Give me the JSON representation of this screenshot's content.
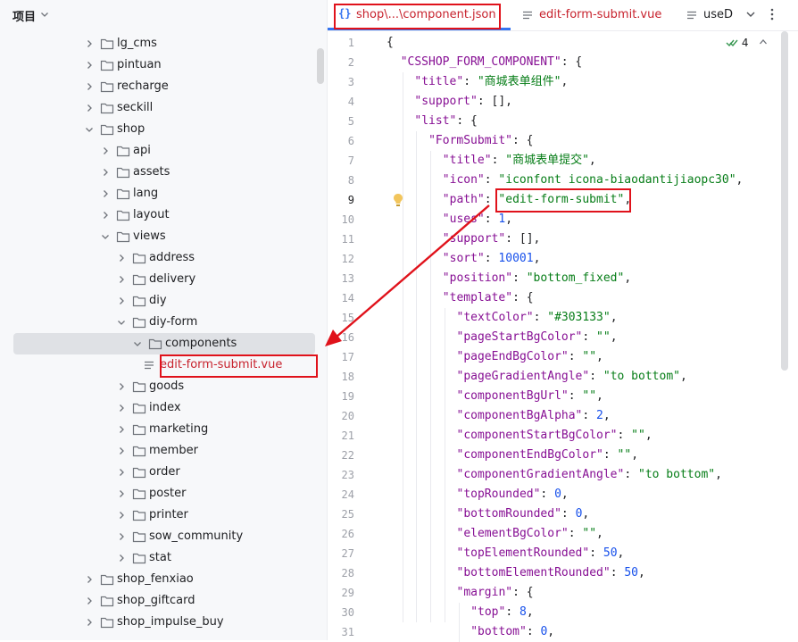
{
  "project_panel": {
    "title": "项目",
    "items": [
      {
        "label": "lg_cms",
        "depth": 0,
        "expanded": false,
        "kind": "folder"
      },
      {
        "label": "pintuan",
        "depth": 0,
        "expanded": false,
        "kind": "folder"
      },
      {
        "label": "recharge",
        "depth": 0,
        "expanded": false,
        "kind": "folder"
      },
      {
        "label": "seckill",
        "depth": 0,
        "expanded": false,
        "kind": "folder"
      },
      {
        "label": "shop",
        "depth": 0,
        "expanded": true,
        "kind": "folder"
      },
      {
        "label": "api",
        "depth": 1,
        "expanded": false,
        "kind": "folder"
      },
      {
        "label": "assets",
        "depth": 1,
        "expanded": false,
        "kind": "folder"
      },
      {
        "label": "lang",
        "depth": 1,
        "expanded": false,
        "kind": "folder"
      },
      {
        "label": "layout",
        "depth": 1,
        "expanded": false,
        "kind": "folder"
      },
      {
        "label": "views",
        "depth": 1,
        "expanded": true,
        "kind": "folder"
      },
      {
        "label": "address",
        "depth": 2,
        "expanded": false,
        "kind": "folder"
      },
      {
        "label": "delivery",
        "depth": 2,
        "expanded": false,
        "kind": "folder"
      },
      {
        "label": "diy",
        "depth": 2,
        "expanded": false,
        "kind": "folder"
      },
      {
        "label": "diy-form",
        "depth": 2,
        "expanded": true,
        "kind": "folder"
      },
      {
        "label": "components",
        "depth": 3,
        "expanded": true,
        "kind": "folder",
        "selected": true
      },
      {
        "label": "edit-form-submit.vue",
        "depth": 4,
        "kind": "file"
      },
      {
        "label": "goods",
        "depth": 2,
        "expanded": false,
        "kind": "folder"
      },
      {
        "label": "index",
        "depth": 2,
        "expanded": false,
        "kind": "folder"
      },
      {
        "label": "marketing",
        "depth": 2,
        "expanded": false,
        "kind": "folder"
      },
      {
        "label": "member",
        "depth": 2,
        "expanded": false,
        "kind": "folder"
      },
      {
        "label": "order",
        "depth": 2,
        "expanded": false,
        "kind": "folder"
      },
      {
        "label": "poster",
        "depth": 2,
        "expanded": false,
        "kind": "folder"
      },
      {
        "label": "printer",
        "depth": 2,
        "expanded": false,
        "kind": "folder"
      },
      {
        "label": "sow_community",
        "depth": 2,
        "expanded": false,
        "kind": "folder"
      },
      {
        "label": "stat",
        "depth": 2,
        "expanded": false,
        "kind": "folder"
      },
      {
        "label": "shop_fenxiao",
        "depth": 0,
        "expanded": false,
        "kind": "folder"
      },
      {
        "label": "shop_giftcard",
        "depth": 0,
        "expanded": false,
        "kind": "folder"
      },
      {
        "label": "shop_impulse_buy",
        "depth": 0,
        "expanded": false,
        "kind": "folder"
      }
    ]
  },
  "tabs": [
    {
      "label": "shop\\...\\component.json",
      "icon": "json-braces-icon",
      "active": true
    },
    {
      "label": "edit-form-submit.vue",
      "icon": "vue-file-icon",
      "active": false
    },
    {
      "label": "useD",
      "icon": "vue-file-icon",
      "active": false
    }
  ],
  "inspection": {
    "count": "4",
    "icon": "check-double-icon"
  },
  "editor": {
    "current_line": 9,
    "lines": [
      {
        "n": 1,
        "indent": 0,
        "tokens": [
          [
            "p",
            "{"
          ]
        ]
      },
      {
        "n": 2,
        "indent": 1,
        "tokens": [
          [
            "k",
            "\"CSSHOP_FORM_COMPONENT\""
          ],
          [
            "p",
            ": {"
          ]
        ]
      },
      {
        "n": 3,
        "indent": 2,
        "tokens": [
          [
            "k",
            "\"title\""
          ],
          [
            "p",
            ": "
          ],
          [
            "s",
            "\"商城表单组件\""
          ],
          [
            "p",
            ","
          ]
        ]
      },
      {
        "n": 4,
        "indent": 2,
        "tokens": [
          [
            "k",
            "\"support\""
          ],
          [
            "p",
            ": [],"
          ]
        ]
      },
      {
        "n": 5,
        "indent": 2,
        "tokens": [
          [
            "k",
            "\"list\""
          ],
          [
            "p",
            ": {"
          ]
        ]
      },
      {
        "n": 6,
        "indent": 3,
        "tokens": [
          [
            "k",
            "\"FormSubmit\""
          ],
          [
            "p",
            ": {"
          ]
        ]
      },
      {
        "n": 7,
        "indent": 4,
        "tokens": [
          [
            "k",
            "\"title\""
          ],
          [
            "p",
            ": "
          ],
          [
            "s",
            "\"商城表单提交\""
          ],
          [
            "p",
            ","
          ]
        ]
      },
      {
        "n": 8,
        "indent": 4,
        "tokens": [
          [
            "k",
            "\"icon\""
          ],
          [
            "p",
            ": "
          ],
          [
            "s",
            "\"iconfont icona-biaodantijiaopc30\""
          ],
          [
            "p",
            ","
          ]
        ]
      },
      {
        "n": 9,
        "indent": 4,
        "tokens": [
          [
            "k",
            "\"path\""
          ],
          [
            "p",
            ": "
          ],
          [
            "s",
            "\"edit-form-submit\""
          ],
          [
            "p",
            ","
          ]
        ]
      },
      {
        "n": 10,
        "indent": 4,
        "tokens": [
          [
            "k",
            "\"uses\""
          ],
          [
            "p",
            ": "
          ],
          [
            "n",
            "1"
          ],
          [
            "p",
            ","
          ]
        ]
      },
      {
        "n": 11,
        "indent": 4,
        "tokens": [
          [
            "k",
            "\"support\""
          ],
          [
            "p",
            ": [],"
          ]
        ]
      },
      {
        "n": 12,
        "indent": 4,
        "tokens": [
          [
            "k",
            "\"sort\""
          ],
          [
            "p",
            ": "
          ],
          [
            "n",
            "10001"
          ],
          [
            "p",
            ","
          ]
        ]
      },
      {
        "n": 13,
        "indent": 4,
        "tokens": [
          [
            "k",
            "\"position\""
          ],
          [
            "p",
            ": "
          ],
          [
            "s",
            "\"bottom_fixed\""
          ],
          [
            "p",
            ","
          ]
        ]
      },
      {
        "n": 14,
        "indent": 4,
        "tokens": [
          [
            "k",
            "\"template\""
          ],
          [
            "p",
            ": {"
          ]
        ]
      },
      {
        "n": 15,
        "indent": 5,
        "tokens": [
          [
            "k",
            "\"textColor\""
          ],
          [
            "p",
            ": "
          ],
          [
            "s",
            "\"#303133\""
          ],
          [
            "p",
            ","
          ]
        ]
      },
      {
        "n": 16,
        "indent": 5,
        "tokens": [
          [
            "k",
            "\"pageStartBgColor\""
          ],
          [
            "p",
            ": "
          ],
          [
            "s",
            "\"\""
          ],
          [
            "p",
            ","
          ]
        ]
      },
      {
        "n": 17,
        "indent": 5,
        "tokens": [
          [
            "k",
            "\"pageEndBgColor\""
          ],
          [
            "p",
            ": "
          ],
          [
            "s",
            "\"\""
          ],
          [
            "p",
            ","
          ]
        ]
      },
      {
        "n": 18,
        "indent": 5,
        "tokens": [
          [
            "k",
            "\"pageGradientAngle\""
          ],
          [
            "p",
            ": "
          ],
          [
            "s",
            "\"to bottom\""
          ],
          [
            "p",
            ","
          ]
        ]
      },
      {
        "n": 19,
        "indent": 5,
        "tokens": [
          [
            "k",
            "\"componentBgUrl\""
          ],
          [
            "p",
            ": "
          ],
          [
            "s",
            "\"\""
          ],
          [
            "p",
            ","
          ]
        ]
      },
      {
        "n": 20,
        "indent": 5,
        "tokens": [
          [
            "k",
            "\"componentBgAlpha\""
          ],
          [
            "p",
            ": "
          ],
          [
            "n",
            "2"
          ],
          [
            "p",
            ","
          ]
        ]
      },
      {
        "n": 21,
        "indent": 5,
        "tokens": [
          [
            "k",
            "\"componentStartBgColor\""
          ],
          [
            "p",
            ": "
          ],
          [
            "s",
            "\"\""
          ],
          [
            "p",
            ","
          ]
        ]
      },
      {
        "n": 22,
        "indent": 5,
        "tokens": [
          [
            "k",
            "\"componentEndBgColor\""
          ],
          [
            "p",
            ": "
          ],
          [
            "s",
            "\"\""
          ],
          [
            "p",
            ","
          ]
        ]
      },
      {
        "n": 23,
        "indent": 5,
        "tokens": [
          [
            "k",
            "\"componentGradientAngle\""
          ],
          [
            "p",
            ": "
          ],
          [
            "s",
            "\"to bottom\""
          ],
          [
            "p",
            ","
          ]
        ]
      },
      {
        "n": 24,
        "indent": 5,
        "tokens": [
          [
            "k",
            "\"topRounded\""
          ],
          [
            "p",
            ": "
          ],
          [
            "n",
            "0"
          ],
          [
            "p",
            ","
          ]
        ]
      },
      {
        "n": 25,
        "indent": 5,
        "tokens": [
          [
            "k",
            "\"bottomRounded\""
          ],
          [
            "p",
            ": "
          ],
          [
            "n",
            "0"
          ],
          [
            "p",
            ","
          ]
        ]
      },
      {
        "n": 26,
        "indent": 5,
        "tokens": [
          [
            "k",
            "\"elementBgColor\""
          ],
          [
            "p",
            ": "
          ],
          [
            "s",
            "\"\""
          ],
          [
            "p",
            ","
          ]
        ]
      },
      {
        "n": 27,
        "indent": 5,
        "tokens": [
          [
            "k",
            "\"topElementRounded\""
          ],
          [
            "p",
            ": "
          ],
          [
            "n",
            "50"
          ],
          [
            "p",
            ","
          ]
        ]
      },
      {
        "n": 28,
        "indent": 5,
        "tokens": [
          [
            "k",
            "\"bottomElementRounded\""
          ],
          [
            "p",
            ": "
          ],
          [
            "n",
            "50"
          ],
          [
            "p",
            ","
          ]
        ]
      },
      {
        "n": 29,
        "indent": 5,
        "tokens": [
          [
            "k",
            "\"margin\""
          ],
          [
            "p",
            ": {"
          ]
        ]
      },
      {
        "n": 30,
        "indent": 6,
        "tokens": [
          [
            "k",
            "\"top\""
          ],
          [
            "p",
            ": "
          ],
          [
            "n",
            "8"
          ],
          [
            "p",
            ","
          ]
        ]
      },
      {
        "n": 31,
        "indent": 6,
        "tokens": [
          [
            "k",
            "\"bottom\""
          ],
          [
            "p",
            ": "
          ],
          [
            "n",
            "0"
          ],
          [
            "p",
            ","
          ]
        ]
      }
    ]
  },
  "colors": {
    "annotation_red": "#e0121b",
    "accent_blue": "#3574f0",
    "json_key": "#871094",
    "json_string": "#067d17",
    "json_number": "#1750eb"
  }
}
